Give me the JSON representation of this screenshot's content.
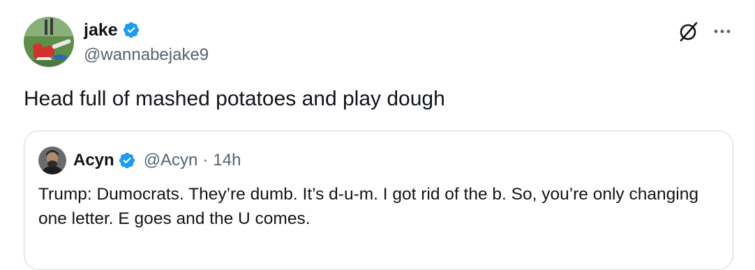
{
  "tweet": {
    "author": {
      "display_name": "jake",
      "handle": "@wannabejake9",
      "verified": true,
      "avatar_icon": "football-player-avatar"
    },
    "actions": {
      "grok_icon": "grok-icon",
      "more_icon": "more-options-icon"
    },
    "text": "Head full of mashed potatoes and play dough"
  },
  "quoted_tweet": {
    "author": {
      "display_name": "Acyn",
      "handle": "@Acyn",
      "verified": true,
      "avatar_icon": "person-avatar"
    },
    "separator": "·",
    "timestamp": "14h",
    "text": "Trump: Dumocrats. They’re dumb. It’s d-u-m. I got rid of the b. So, you’re only changing one letter. E goes and the U comes."
  },
  "colors": {
    "verified_blue": "#1d9bf0",
    "text_primary": "#0f1419",
    "text_secondary": "#536471",
    "border": "#cfd9de"
  }
}
